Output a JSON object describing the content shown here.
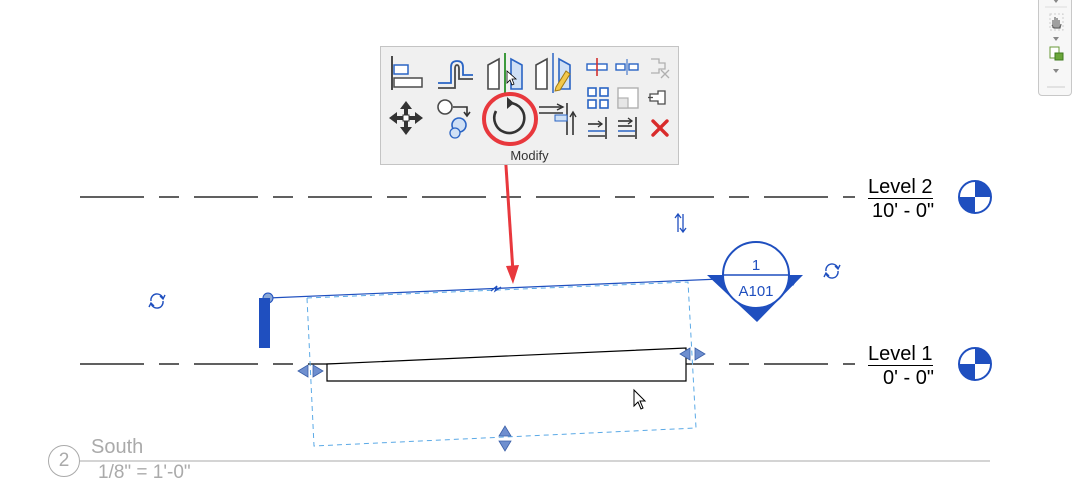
{
  "ribbon": {
    "panel_title": "Modify",
    "tools": [
      {
        "name": "align-tool-icon"
      },
      {
        "name": "offset-tool-icon"
      },
      {
        "name": "mirror-pick-axis-icon"
      },
      {
        "name": "mirror-draw-axis-icon"
      },
      {
        "name": "split-element-icon"
      },
      {
        "name": "split-with-gap-icon"
      },
      {
        "name": "unpin-icon"
      },
      {
        "name": "move-tool-icon"
      },
      {
        "name": "copy-tool-icon"
      },
      {
        "name": "rotate-tool-icon"
      },
      {
        "name": "trim-extend-corner-icon"
      },
      {
        "name": "array-tool-icon"
      },
      {
        "name": "scale-tool-icon"
      },
      {
        "name": "pin-icon"
      },
      {
        "name": "trim-extend-single-icon"
      },
      {
        "name": "trim-extend-multiple-icon"
      },
      {
        "name": "delete-icon"
      }
    ]
  },
  "levels": [
    {
      "name": "Level 2",
      "elevation": "10' - 0\""
    },
    {
      "name": "Level 1",
      "elevation": "0' - 0\""
    }
  ],
  "section_tag": {
    "number": "1",
    "sheet": "A101"
  },
  "view": {
    "number": "2",
    "title": "South",
    "scale": "1/8\" = 1'-0\""
  },
  "colors": {
    "highlight": "#e8383d",
    "revit_blue": "#1f4fbf",
    "selection_blue": "#3a75d6"
  }
}
